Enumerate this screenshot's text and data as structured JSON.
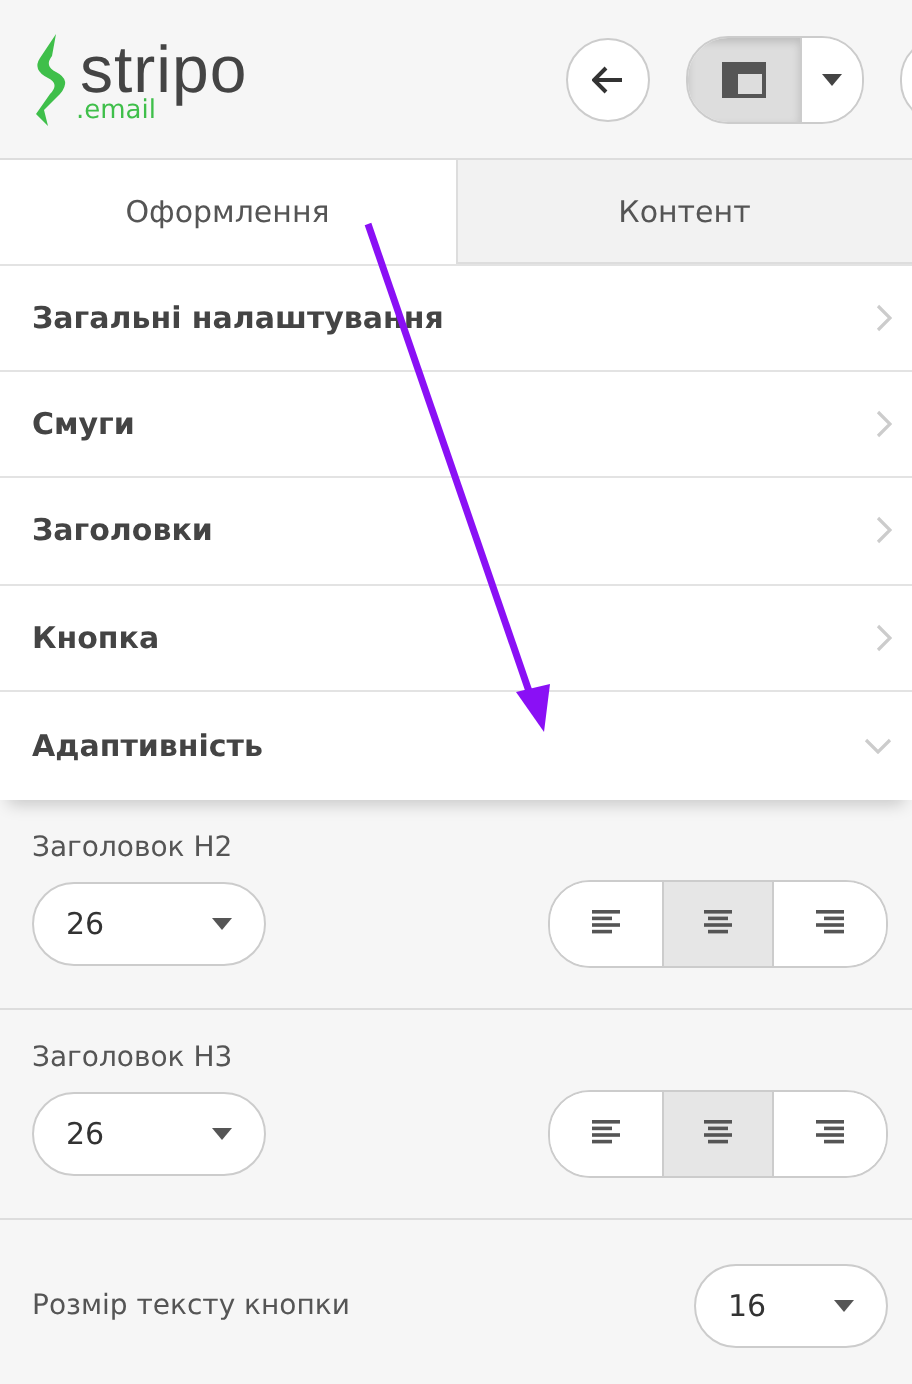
{
  "logo": {
    "name": "stripo",
    "suffix": ".email"
  },
  "toolbar": {
    "layout_toggle_selected": true
  },
  "tabs": [
    {
      "label": "Оформлення",
      "selected": true
    },
    {
      "label": "Контент",
      "selected": false
    }
  ],
  "sections": [
    {
      "label": "Загальні налаштування",
      "expanded": false
    },
    {
      "label": "Смуги",
      "expanded": false
    },
    {
      "label": "Заголовки",
      "expanded": false
    },
    {
      "label": "Кнопка",
      "expanded": false
    },
    {
      "label": "Адаптивність",
      "expanded": true
    }
  ],
  "settings": [
    {
      "kind": "stacked",
      "label": "Заголовок H2",
      "value": "26",
      "align": [
        {
          "selected": false
        },
        {
          "selected": true
        },
        {
          "selected": false
        }
      ]
    },
    {
      "kind": "stacked",
      "label": "Заголовок H3",
      "value": "26",
      "align": [
        {
          "selected": false
        },
        {
          "selected": true
        },
        {
          "selected": false
        }
      ]
    },
    {
      "kind": "inline",
      "label": "Розмір тексту кнопки",
      "value": "16"
    }
  ]
}
